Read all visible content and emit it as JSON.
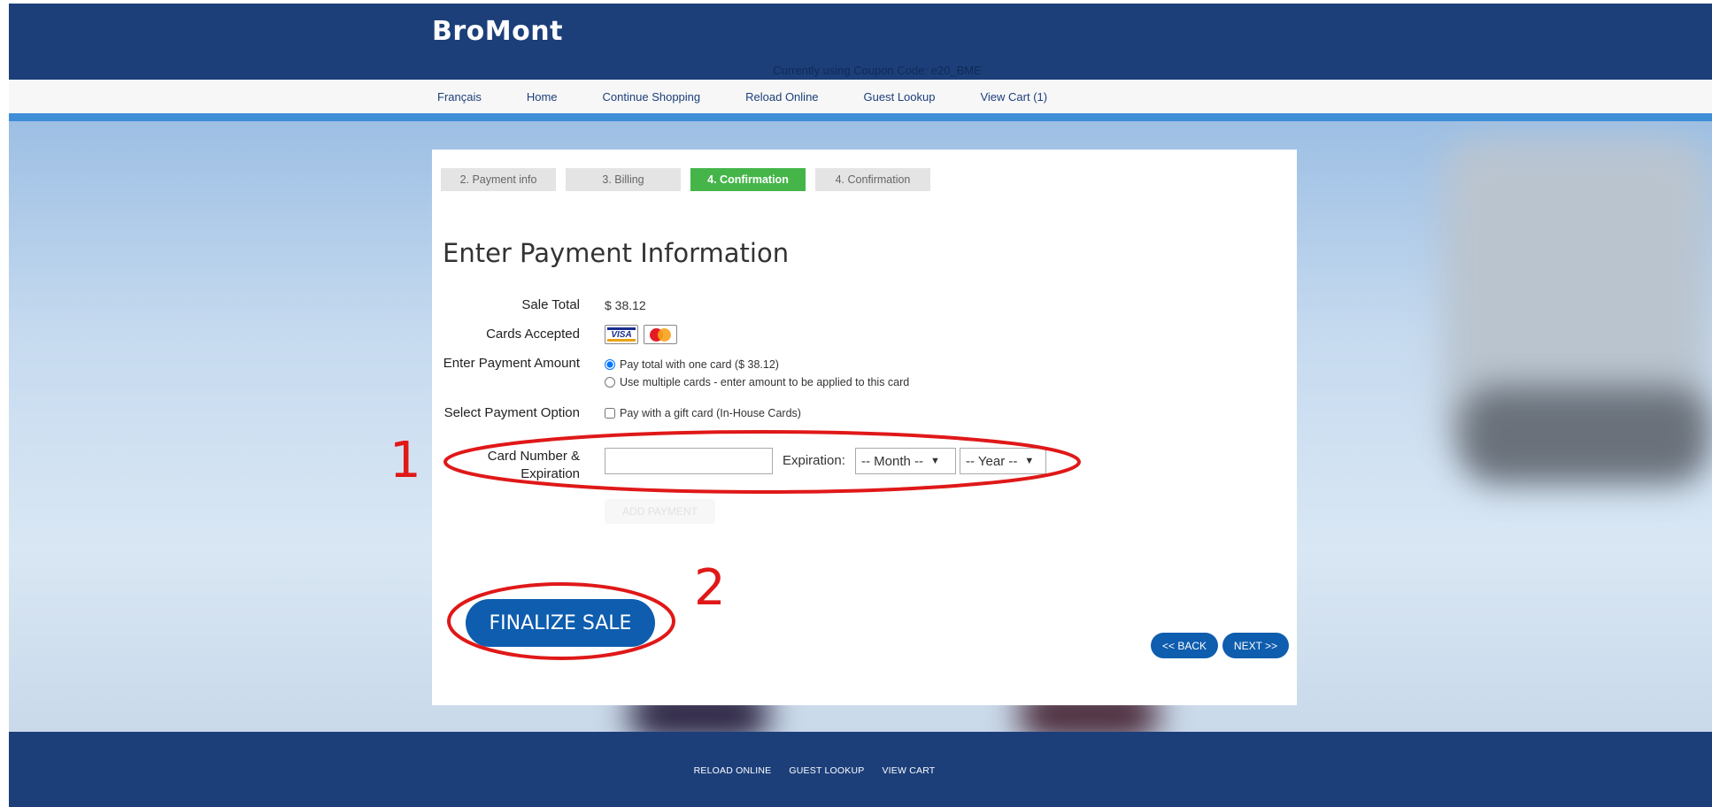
{
  "header": {
    "logo": "BroMont",
    "coupon_text": "Currently using Coupon Code: e20_BME"
  },
  "nav": {
    "items": [
      "Français",
      "Home",
      "Continue Shopping",
      "Reload Online",
      "Guest Lookup",
      "View Cart (1)"
    ]
  },
  "steps": {
    "items": [
      {
        "label": "2. Payment info",
        "active": false
      },
      {
        "label": "3. Billing",
        "active": false
      },
      {
        "label": "4. Confirmation",
        "active": true
      },
      {
        "label": "4. Confirmation",
        "active": false
      }
    ]
  },
  "form": {
    "title": "Enter Payment Information",
    "sale_total_label": "Sale Total",
    "sale_total_value": "$ 38.12",
    "cards_accepted_label": "Cards Accepted",
    "cards": [
      "visa-icon",
      "mastercard-icon"
    ],
    "visa_text": "VISA",
    "payment_amount_label": "Enter Payment Amount",
    "payment_amount_options": [
      {
        "label": "Pay total with one card ($ 38.12)",
        "checked": true
      },
      {
        "label": "Use multiple cards - enter amount to be applied to this card",
        "checked": false
      }
    ],
    "payment_option_label": "Select Payment Option",
    "gift_card_label": "Pay with a gift card (In-House Cards)",
    "gift_card_checked": false,
    "card_number_label": "Card Number & Expiration",
    "card_number_value": "",
    "expiration_label": "Expiration:",
    "month_selected": "-- Month --",
    "year_selected": "-- Year --",
    "add_payment_label": "ADD PAYMENT",
    "finalize_label": "FINALIZE SALE",
    "back_label": "<< BACK",
    "next_label": "NEXT >>"
  },
  "footer": {
    "links": [
      "RELOAD ONLINE",
      "GUEST LOOKUP",
      "VIEW CART"
    ]
  },
  "annotations": {
    "marker_1": "1",
    "marker_2": "2",
    "color": "#e01818"
  },
  "colors": {
    "header_bg": "#1c3f7a",
    "accent_blue": "#0e5dae",
    "active_step": "#45b549"
  }
}
